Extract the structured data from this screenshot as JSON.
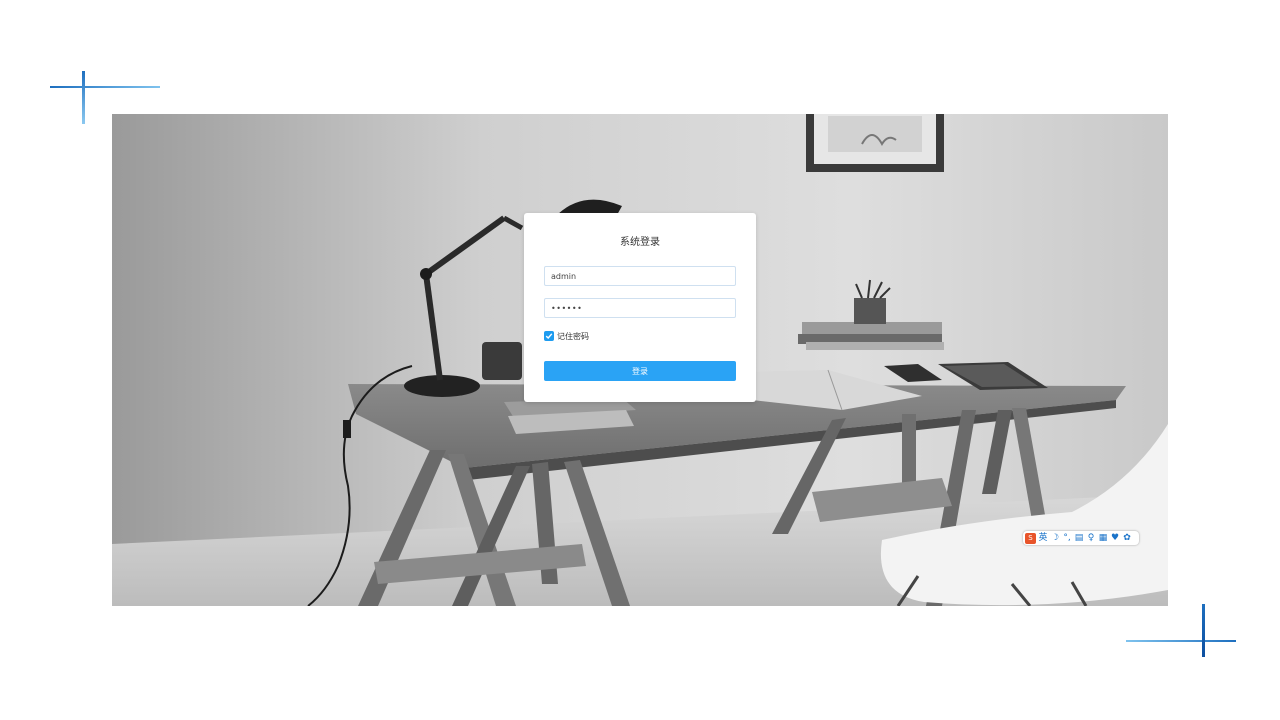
{
  "login": {
    "title": "系统登录",
    "username_value": "admin",
    "password_value": "••••••",
    "remember_label": "记住密码",
    "submit_label": "登录",
    "remember_checked": true
  },
  "ime_toolbar": {
    "logo": "S",
    "items": [
      {
        "label": "英",
        "icon": "language-icon"
      },
      {
        "label": "☽",
        "icon": "moon-icon"
      },
      {
        "label": "°,",
        "icon": "punctuation-icon"
      },
      {
        "label": "▤",
        "icon": "keyboard-icon"
      },
      {
        "label": "♀",
        "icon": "user-icon"
      },
      {
        "label": "▦",
        "icon": "toolbox-icon"
      },
      {
        "label": "♥",
        "icon": "skin-icon"
      },
      {
        "label": "✿",
        "icon": "settings-icon"
      }
    ]
  },
  "colors": {
    "accent": "#2aa3f5",
    "corner_blue": "#1e6fbf",
    "ime_logo": "#e8542a"
  }
}
